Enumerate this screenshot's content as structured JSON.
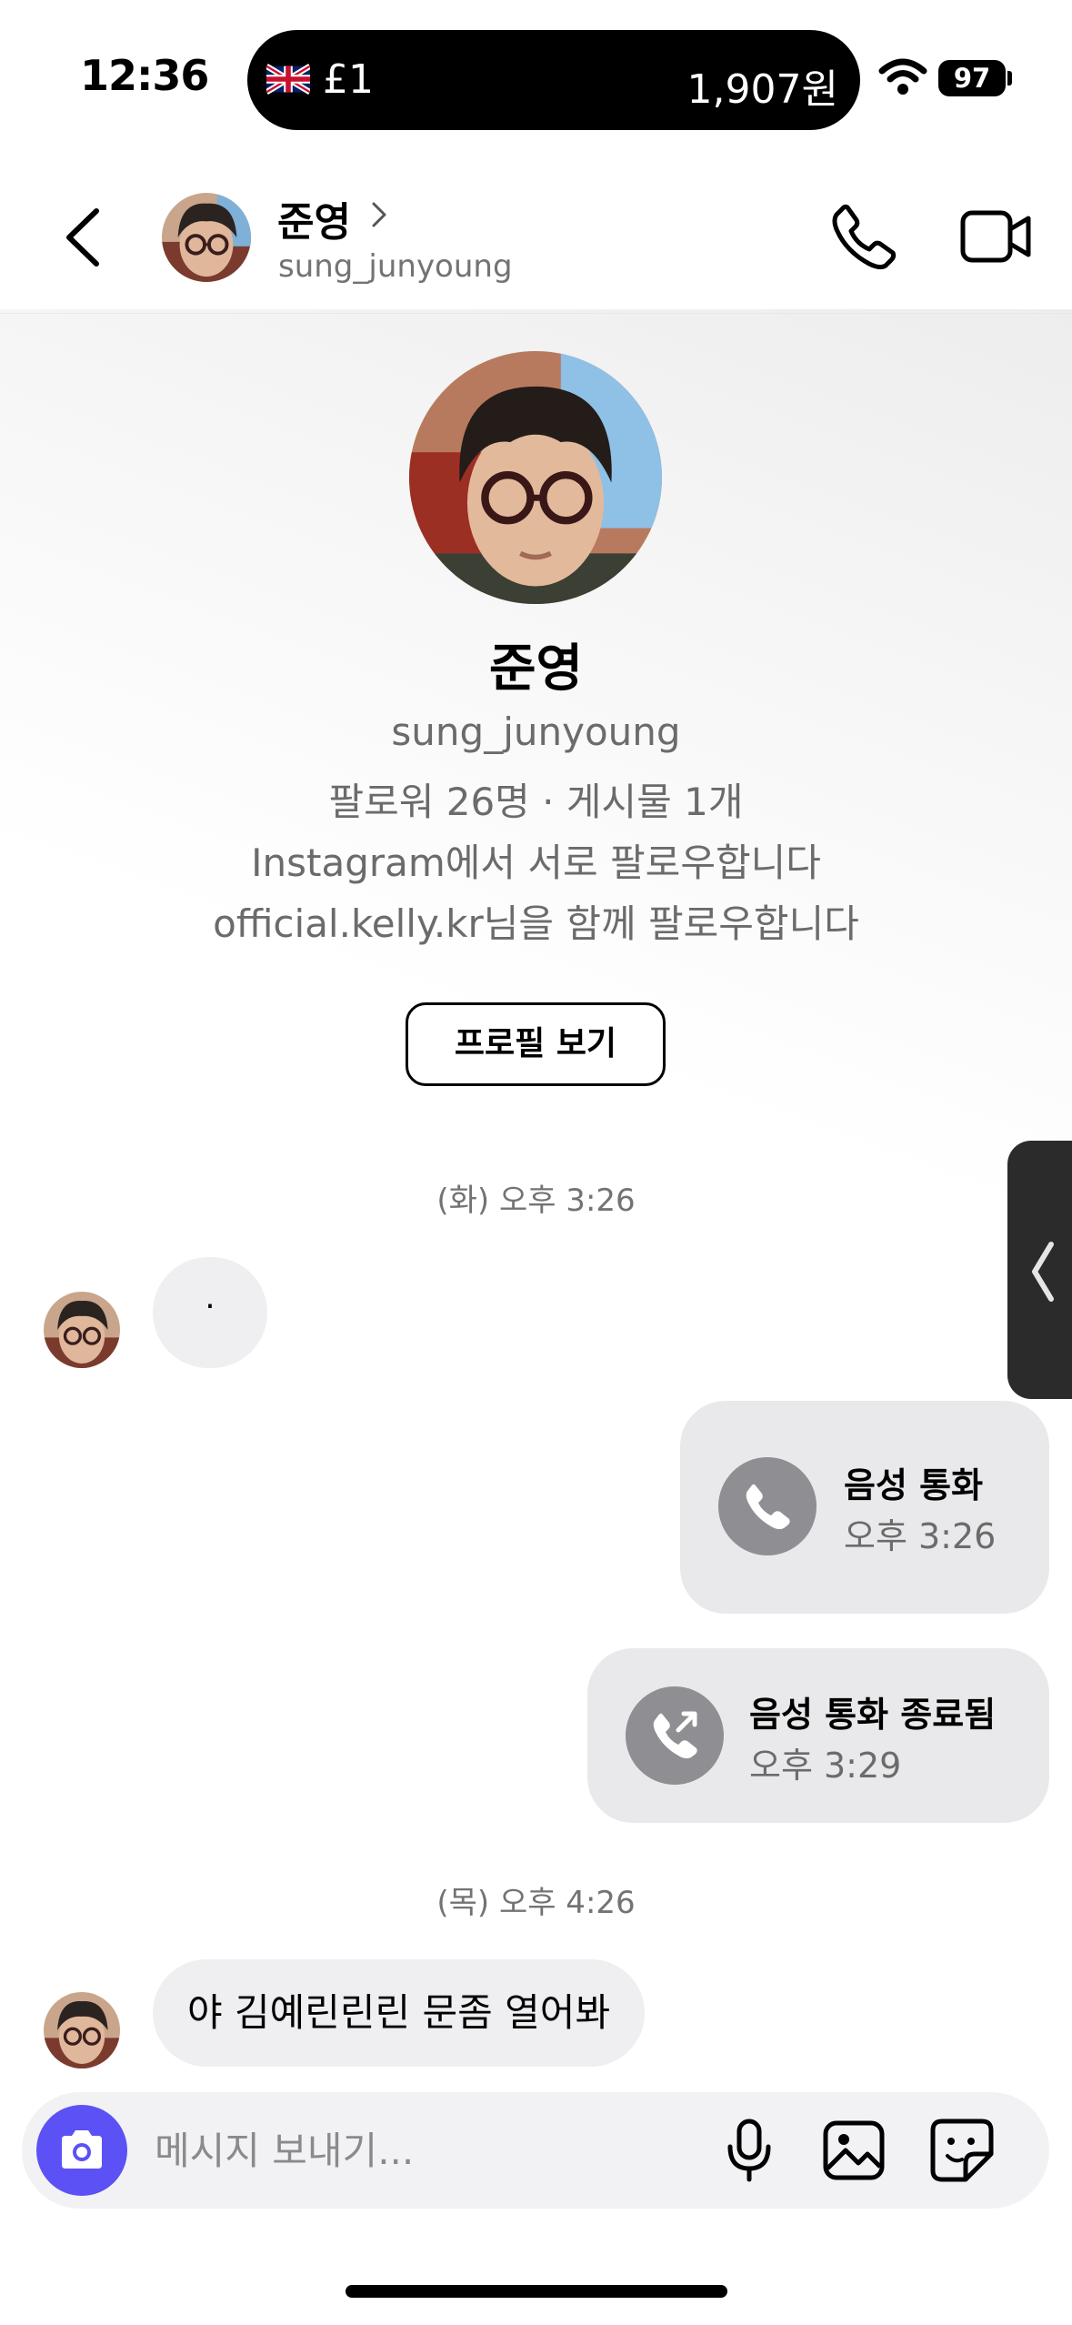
{
  "status_bar": {
    "time": "12:36",
    "pill_left": "£1",
    "pill_right": "1,907원",
    "battery": "97"
  },
  "header": {
    "name": "준영",
    "username": "sung_junyoung"
  },
  "profile": {
    "name": "준영",
    "username": "sung_junyoung",
    "stats": "팔로워 26명 · 게시물 1개",
    "mutual": "Instagram에서 서로 팔로우합니다",
    "followed_by": "official.kelly.kr님을 함께 팔로우합니다",
    "view_profile": "프로필 보기"
  },
  "thread": {
    "ts1": "(화) 오후 3:26",
    "msg1": "·",
    "call1_title": "음성 통화",
    "call1_time": "오후 3:26",
    "call2_title": "음성 통화 종료됨",
    "call2_time": "오후 3:29",
    "ts2": "(목) 오후 4:26",
    "msg2": "야 김예린린린 문좀 열어봐"
  },
  "composer": {
    "placeholder": "메시지 보내기..."
  },
  "colors": {
    "accent": "#5b51f5",
    "bubble": "#efeff1",
    "call_icon_bg": "#8e8e93"
  }
}
